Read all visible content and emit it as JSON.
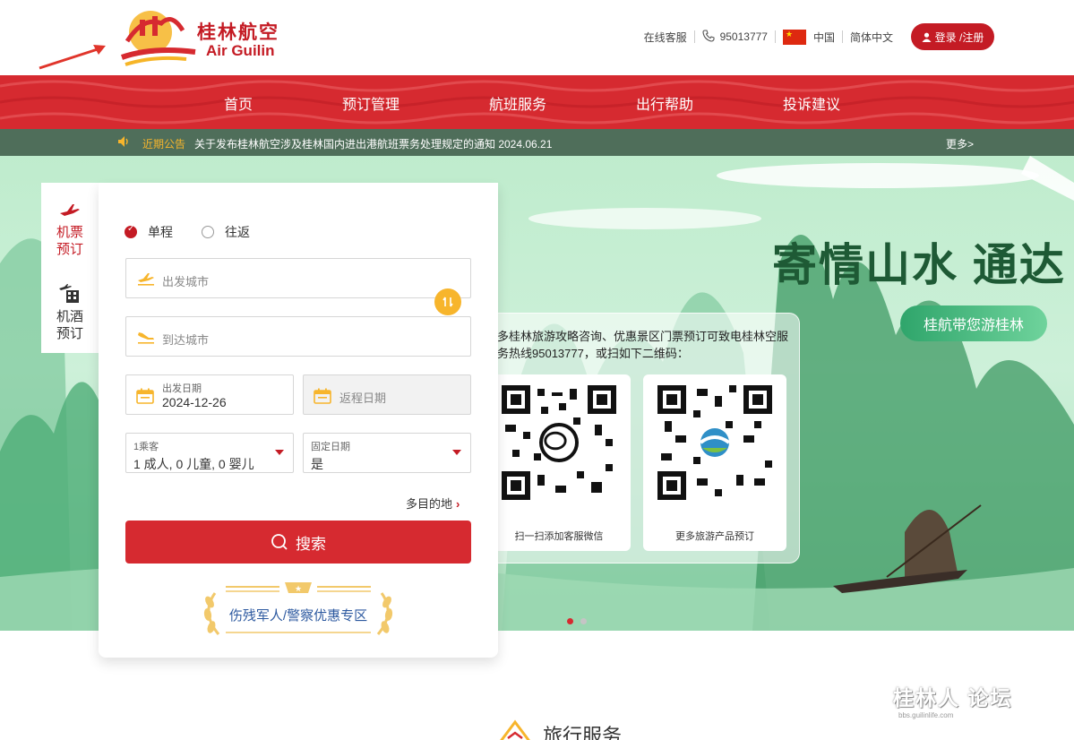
{
  "header": {
    "logo_cn": "桂林航空",
    "logo_en": "Air Guilin",
    "online_service": "在线客服",
    "hotline": "95013777",
    "region": "中国",
    "language": "简体中文",
    "login": "登录 /注册"
  },
  "nav": {
    "items": [
      "首页",
      "预订管理",
      "航班服务",
      "出行帮助",
      "投诉建议"
    ]
  },
  "notice": {
    "label": "近期公告",
    "message": "关于发布桂林航空涉及桂林国内进出港航班票务处理规定的通知 2024.06.21",
    "more": "更多>"
  },
  "hero": {
    "title": "寄情山水 通达",
    "tag": "桂航带您游桂林",
    "qr_text": "多桂林旅游攻略咨询、优惠景区门票预订可致电桂林空服务热线95013777，或扫如下二维码：",
    "qr_captions": [
      "扫一扫添加客服微信",
      "更多旅游产品预订"
    ],
    "slides": 2,
    "active_slide": 0
  },
  "booking": {
    "tabs": [
      "机票预订",
      "机酒预订"
    ],
    "active_tab": 0,
    "trip_types": [
      "单程",
      "往返"
    ],
    "selected_trip": 0,
    "from_placeholder": "出发城市",
    "to_placeholder": "到达城市",
    "depart_label": "出发日期",
    "depart_value": "2024-12-26",
    "return_placeholder": "返程日期",
    "passengers_label": "1乘客",
    "passengers_value": "1 成人, 0 儿童, 0 婴儿",
    "fixed_label": "固定日期",
    "fixed_value": "是",
    "multi": "多目的地",
    "search": "搜索",
    "promo": "伤残军人/警察优惠专区"
  },
  "section": {
    "title": "旅行服务"
  },
  "watermark": {
    "main": "桂林人 论坛",
    "sub": "bbs.guilinlife.com"
  },
  "colors": {
    "brand_red": "#d62a30",
    "accent_yellow": "#f7b52c",
    "notice_bg": "#4f6e5a"
  }
}
